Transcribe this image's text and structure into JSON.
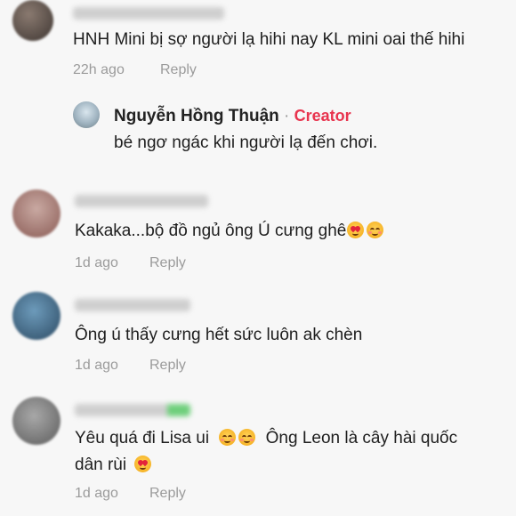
{
  "comments": [
    {
      "text": "HNH Mini bị sợ người lạ hihi nay KL mini oai thế hihi",
      "time": "22h ago",
      "reply": "Reply"
    },
    {
      "text": "Kakaka...bộ đồ ngủ ông Ú cưng ghê",
      "time": "1d ago",
      "reply": "Reply"
    },
    {
      "text": "Ông ú thấy cưng hết sức luôn ak chèn",
      "time": "1d ago",
      "reply": "Reply"
    },
    {
      "text_a": "Yêu quá đi Lisa ui",
      "text_b": "Ông Leon là cây hài quốc",
      "text_c": "dân rùi",
      "time": "1d ago",
      "reply": "Reply"
    }
  ],
  "creator_reply": {
    "name": "Nguyễn Hồng Thuận",
    "separator": "·",
    "tag": "Creator",
    "text": "bé ngơ ngác khi người lạ đến chơi."
  },
  "colors": {
    "creator_tag": "#e8344e",
    "meta_text": "#9b9b9b",
    "background": "#f7f7f7"
  },
  "icons": [
    "smiling-face-hearts-emoji",
    "heart-eyes-emoji"
  ]
}
